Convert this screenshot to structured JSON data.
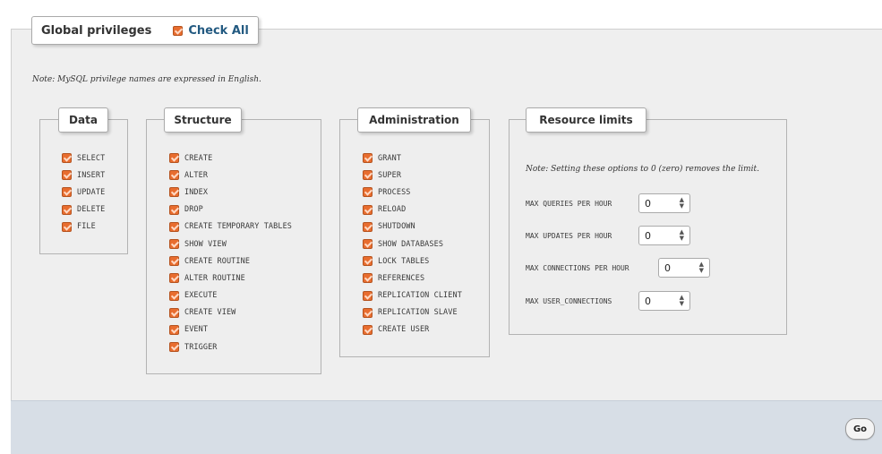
{
  "header": {
    "title": "Global privileges",
    "check_all_label": "Check All"
  },
  "note": "Note: MySQL privilege names are expressed in English.",
  "groups": {
    "data": {
      "title": "Data",
      "items": [
        {
          "label": "SELECT",
          "checked": true
        },
        {
          "label": "INSERT",
          "checked": true
        },
        {
          "label": "UPDATE",
          "checked": true
        },
        {
          "label": "DELETE",
          "checked": true
        },
        {
          "label": "FILE",
          "checked": true
        }
      ]
    },
    "structure": {
      "title": "Structure",
      "items": [
        {
          "label": "CREATE",
          "checked": true
        },
        {
          "label": "ALTER",
          "checked": true
        },
        {
          "label": "INDEX",
          "checked": true
        },
        {
          "label": "DROP",
          "checked": true
        },
        {
          "label": "CREATE TEMPORARY TABLES",
          "checked": true
        },
        {
          "label": "SHOW VIEW",
          "checked": true
        },
        {
          "label": "CREATE ROUTINE",
          "checked": true
        },
        {
          "label": "ALTER ROUTINE",
          "checked": true
        },
        {
          "label": "EXECUTE",
          "checked": true
        },
        {
          "label": "CREATE VIEW",
          "checked": true
        },
        {
          "label": "EVENT",
          "checked": true
        },
        {
          "label": "TRIGGER",
          "checked": true
        }
      ]
    },
    "administration": {
      "title": "Administration",
      "items": [
        {
          "label": "GRANT",
          "checked": true
        },
        {
          "label": "SUPER",
          "checked": true
        },
        {
          "label": "PROCESS",
          "checked": true
        },
        {
          "label": "RELOAD",
          "checked": true
        },
        {
          "label": "SHUTDOWN",
          "checked": true
        },
        {
          "label": "SHOW DATABASES",
          "checked": true
        },
        {
          "label": "LOCK TABLES",
          "checked": true
        },
        {
          "label": "REFERENCES",
          "checked": true
        },
        {
          "label": "REPLICATION CLIENT",
          "checked": true
        },
        {
          "label": "REPLICATION SLAVE",
          "checked": true
        },
        {
          "label": "CREATE USER",
          "checked": true
        }
      ]
    },
    "resource_limits": {
      "title": "Resource limits",
      "note": "Note: Setting these options to 0 (zero) removes the limit.",
      "fields": [
        {
          "label": "MAX QUERIES PER HOUR",
          "value": "0"
        },
        {
          "label": "MAX UPDATES PER HOUR",
          "value": "0"
        },
        {
          "label": "MAX CONNECTIONS PER HOUR",
          "value": "0"
        },
        {
          "label": "MAX USER_CONNECTIONS",
          "value": "0"
        }
      ]
    }
  },
  "footer": {
    "go_label": "Go"
  },
  "colors": {
    "checkbox": "#e86d2f",
    "link": "#235a81",
    "footer_bg": "#d7dee6"
  }
}
